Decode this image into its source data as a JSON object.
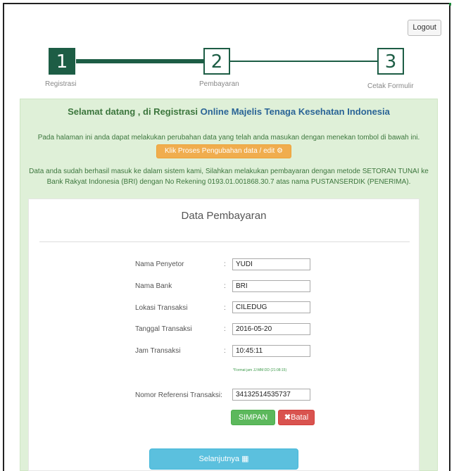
{
  "header": {
    "logout_label": "Logout"
  },
  "stepper": {
    "steps": [
      {
        "number": "1",
        "label": "Registrasi",
        "state": "active"
      },
      {
        "number": "2",
        "label": "Pembayaran",
        "state": "pending"
      },
      {
        "number": "3",
        "label": "Cetak Formulir",
        "state": "pending"
      }
    ]
  },
  "welcome": {
    "prefix": "Selamat datang , di Registrasi ",
    "highlight": "Online Majelis Tenaga Kesehatan Indonesia"
  },
  "info": {
    "edit_text": "Pada halaman ini anda dapat melakukan perubahan data yang telah anda masukan dengan menekan tombol di bawah ini.",
    "edit_button": "Klik Proses Pengubahan data / edit",
    "edit_icon": "settings-icon",
    "payment_text": "Data anda sudah berhasil masuk ke dalam sistem kami, Silahkan melakukan pembayaran dengan metode SETORAN TUNAI ke Bank Rakyat Indonesia (BRI) dengan No Rekening 0193.01.001868.30.7 atas nama PUSTANSERDIK (PENERIMA)."
  },
  "form": {
    "title": "Data Pembayaran",
    "fields": [
      {
        "label": "Nama Penyetor",
        "value": "YUDI"
      },
      {
        "label": "Nama Bank",
        "value": "BRI"
      },
      {
        "label": "Lokasi Transaksi",
        "value": "CILEDUG"
      },
      {
        "label": "Tanggal Transaksi",
        "value": "2016-05-20"
      },
      {
        "label": "Jam Transaksi",
        "value": "10:45:11"
      },
      {
        "label": "Nomor Referensi Transaksi:",
        "value": "34132514535737"
      }
    ],
    "colon": ":",
    "time_hint": "*Format jam JJ:MM:DD (21:08:15)",
    "save_button": "SIMPAN",
    "cancel_button": "Batal",
    "cancel_icon": "close-icon",
    "next_button": "Selanjutnya",
    "next_icon": "table-icon"
  },
  "colors": {
    "step_green": "#1d5d45",
    "panel_green": "#dff0d8",
    "text_green": "#3c763d",
    "link_blue": "#2a6496",
    "orange": "#f0ad4e",
    "success": "#5cb85c",
    "danger": "#d9534f",
    "info": "#5bc0de"
  }
}
